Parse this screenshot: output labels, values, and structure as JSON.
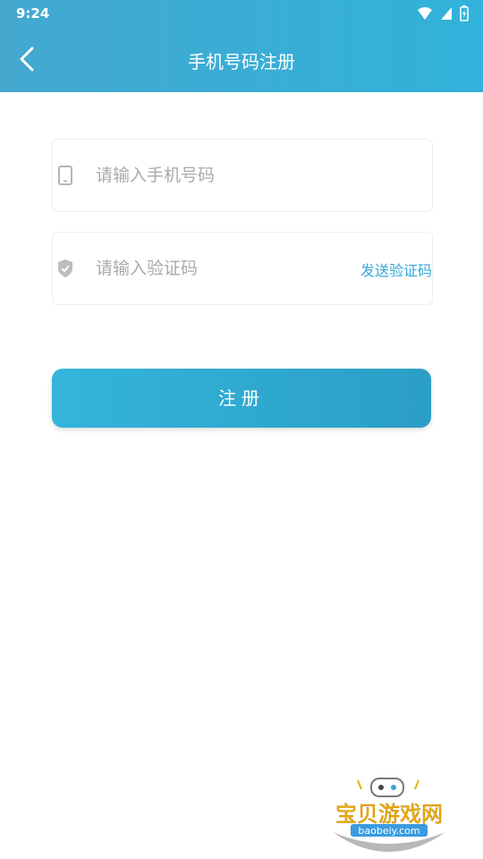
{
  "status_bar": {
    "time": "9:24"
  },
  "header": {
    "title": "手机号码注册"
  },
  "form": {
    "phone_placeholder": "请输入手机号码",
    "code_placeholder": "请输入验证码",
    "send_code_label": "发送验证码",
    "register_label": "注册"
  },
  "watermark": {
    "title": "宝贝游戏网",
    "domain": "baobeiy.com"
  }
}
